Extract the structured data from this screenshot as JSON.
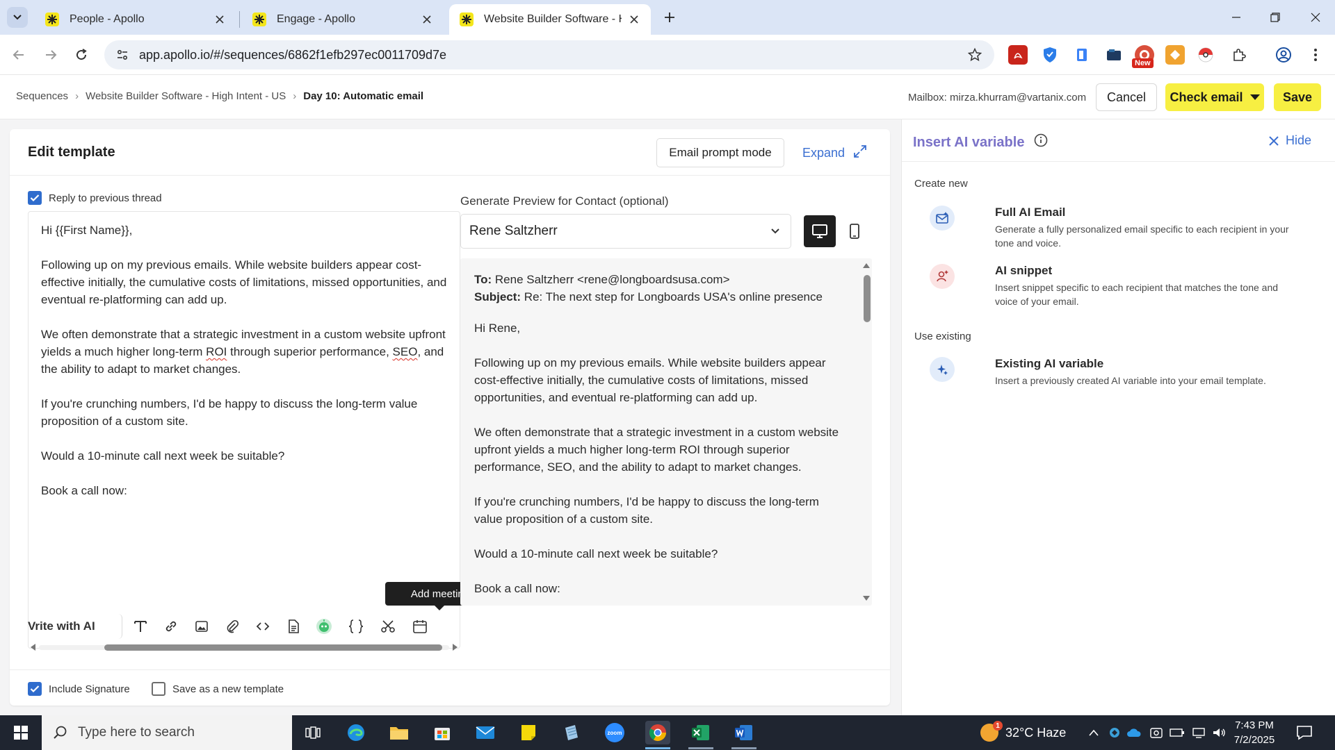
{
  "browser": {
    "tabs": [
      {
        "label": "People - Apollo",
        "active": false
      },
      {
        "label": "Engage - Apollo",
        "active": false
      },
      {
        "label": "Website Builder Software - High",
        "active": true
      }
    ],
    "url": "app.apollo.io/#/sequences/6862f1efb297ec0011709d7e",
    "ext_badge": "New"
  },
  "header": {
    "breadcrumb": [
      "Sequences",
      "Website Builder Software - High Intent - US",
      "Day 10: Automatic email"
    ],
    "mailbox": "Mailbox: mirza.khurram@vartanix.com",
    "cancel_label": "Cancel",
    "check_email_label": "Check email",
    "save_label": "Save"
  },
  "editor": {
    "title": "Edit template",
    "prompt_mode_label": "Email prompt mode",
    "expand_label": "Expand",
    "reply_thread_label": "Reply to previous thread",
    "reply_thread_checked": true,
    "body": {
      "greeting": "Hi {{First Name}},",
      "p1": "Following up on my previous emails. While website builders appear cost-effective initially, the cumulative costs of limitations, missed opportunities, and eventual re-platforming can add up.",
      "p2_a": "We often demonstrate that a strategic investment in a custom website upfront yields a much higher long-term ",
      "p2_roi": "ROI",
      "p2_b": " through superior performance, ",
      "p2_seo": "SEO",
      "p2_c": ", and the ability to adapt to market changes.",
      "p3": "If you're crunching numbers, I'd be happy to discuss the long-term value proposition of a custom site.",
      "p4": "Would a 10-minute call next week be suitable?",
      "p5": "Book a call now:"
    },
    "tooltip": "Add meeting",
    "write_ai_label": "Vrite with AI",
    "include_signature_label": "Include Signature",
    "include_signature_checked": true,
    "save_template_label": "Save as a new template",
    "save_template_checked": false
  },
  "preview": {
    "label": "Generate Preview for Contact (optional)",
    "contact": "Rene Saltzherr",
    "to_label": "To:",
    "to_value": "Rene Saltzherr <rene@longboardsusa.com>",
    "subject_label": "Subject:",
    "subject_value": "Re: The next step for Longboards USA's online presence",
    "greeting": "Hi Rene,",
    "p1": "Following up on my previous emails. While website builders appear cost-effective initially, the cumulative costs of limitations, missed opportunities, and eventual re-platforming can add up.",
    "p2": "We often demonstrate that a strategic investment in a custom website upfront yields a much higher long-term ROI through superior performance, SEO, and the ability to adapt to market changes.",
    "p3": "If you're crunching numbers, I'd be happy to discuss the long-term value proposition of a custom site.",
    "p4": "Would a 10-minute call next week be suitable?",
    "p5": "Book a call now:"
  },
  "ai_panel": {
    "title": "Insert AI variable",
    "hide_label": "Hide",
    "create_new_heading": "Create new",
    "full_ai_title": "Full AI Email",
    "full_ai_desc": "Generate a fully personalized email specific to each recipient in your tone and voice.",
    "snippet_title": "AI snippet",
    "snippet_desc": "Insert snippet specific to each recipient that matches the tone and voice of your email.",
    "use_existing_heading": "Use existing",
    "existing_title": "Existing AI variable",
    "existing_desc": "Insert a previously created AI variable into your email template."
  },
  "taskbar": {
    "search_placeholder": "Type here to search",
    "weather": "32°C  Haze",
    "weather_badge": "1",
    "time": "7:43 PM",
    "date": "7/2/2025"
  },
  "colors": {
    "accent_yellow": "#f7ef42",
    "link_blue": "#3b6fd1",
    "ai_purple": "#7a72c8",
    "checkbox_blue": "#2f6ccd"
  }
}
